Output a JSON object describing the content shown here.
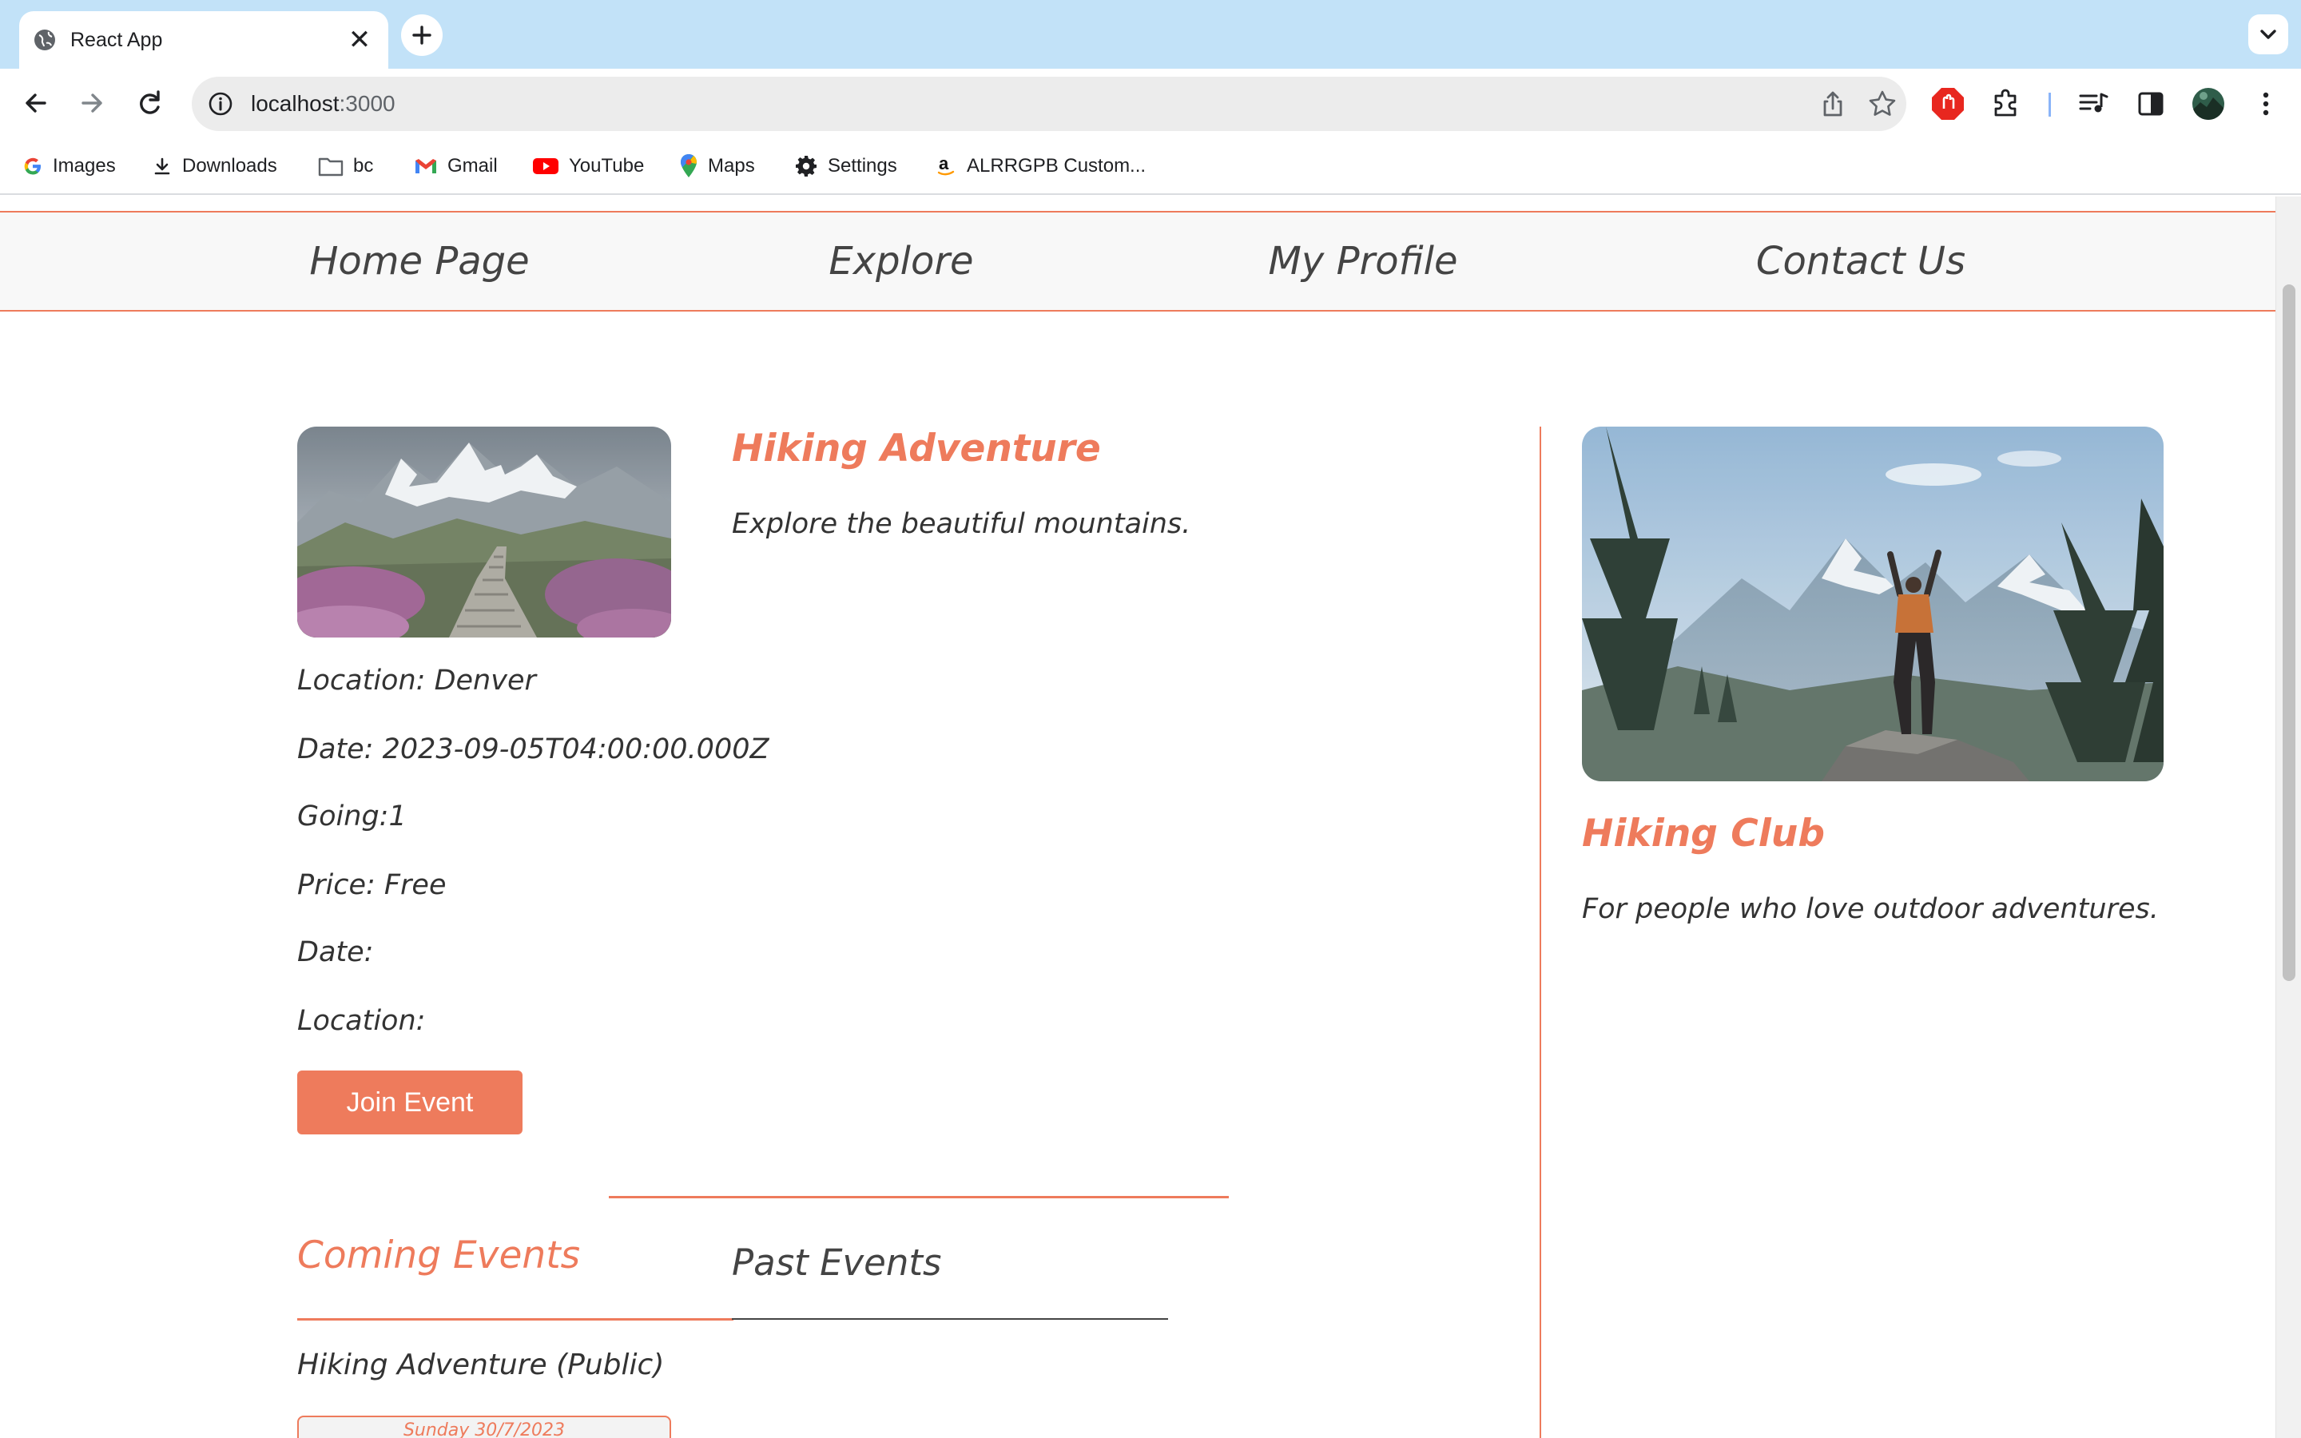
{
  "browser": {
    "tab_title": "React App",
    "url_host": "localhost",
    "url_port": ":3000",
    "bookmarks": [
      {
        "label": "Images",
        "icon": "google-icon"
      },
      {
        "label": "Downloads",
        "icon": "download-icon"
      },
      {
        "label": "bc",
        "icon": "folder-icon"
      },
      {
        "label": "Gmail",
        "icon": "gmail-icon"
      },
      {
        "label": "YouTube",
        "icon": "youtube-icon"
      },
      {
        "label": "Maps",
        "icon": "maps-icon"
      },
      {
        "label": "Settings",
        "icon": "gear-icon"
      },
      {
        "label": "ALRRGPB Custom...",
        "icon": "amazon-icon"
      }
    ]
  },
  "nav": {
    "home": "Home Page",
    "explore": "Explore",
    "profile": "My Profile",
    "contact": "Contact Us"
  },
  "event": {
    "title": "Hiking Adventure",
    "description": "Explore the beautiful mountains.",
    "image": "mountain-trail-image",
    "location": "Location: Denver",
    "date": "Date: 2023-09-05T04:00:00.000Z",
    "going": "Going:1",
    "price": "Price: Free",
    "date2": "Date:",
    "location2": "Location:",
    "join_label": "Join Event"
  },
  "tabs": {
    "coming": "Coming Events",
    "past": "Past Events"
  },
  "coming_events": {
    "item": "Hiking Adventure (Public)",
    "date_card": "Sunday 30/7/2023"
  },
  "club": {
    "title": "Hiking Club",
    "description": "For people who love outdoor adventures.",
    "image": "hiker-summit-image"
  },
  "colors": {
    "accent": "#ee7b5c",
    "tabstrip": "#c2e2f8"
  }
}
